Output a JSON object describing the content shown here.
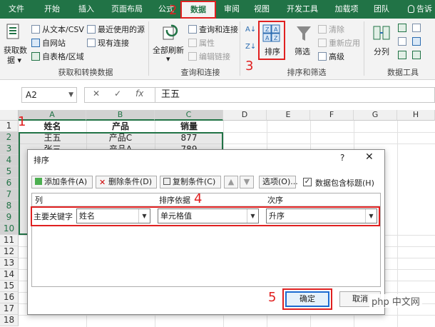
{
  "tabs": [
    "文件",
    "开始",
    "插入",
    "页面布局",
    "公式",
    "数据",
    "审阅",
    "视图",
    "开发工具",
    "加载项",
    "团队"
  ],
  "active_tab_index": 5,
  "tell_me": "告诉",
  "ribbon": {
    "get_data": {
      "big_label_1": "获取数",
      "big_label_2": "据 ▾",
      "from_text": "从文本/CSV",
      "from_web": "自网站",
      "from_table": "自表格/区域",
      "recent": "最近使用的源",
      "existing": "现有连接",
      "group_label": "获取和转换数据"
    },
    "refresh": {
      "big_label_1": "全部刷新",
      "big_label_2": "▾",
      "queries": "查询和连接",
      "properties": "属性",
      "edit_links": "编辑链接",
      "group_label": "查询和连接"
    },
    "sort_filter": {
      "az_top": "A↓",
      "az_bottom": "Z↓",
      "sort_label": "排序",
      "filter_label": "筛选",
      "clear": "清除",
      "reapply": "重新应用",
      "advanced": "高级",
      "group_label": "排序和筛选"
    },
    "data_tools": {
      "split_label": "分列",
      "group_label": "数据工具"
    }
  },
  "formula_bar": {
    "name_box": "A2",
    "cancel": "✕",
    "enter": "✓",
    "fx": "fx",
    "value": "王五"
  },
  "grid": {
    "columns": [
      "A",
      "B",
      "C",
      "D",
      "E",
      "F",
      "G",
      "H"
    ],
    "rows": [
      "1",
      "2",
      "3",
      "4",
      "5",
      "6",
      "7",
      "8",
      "9",
      "10",
      "11",
      "12",
      "13",
      "14",
      "15",
      "16",
      "17",
      "18"
    ],
    "header_cells": [
      "姓名",
      "产品",
      "销量"
    ],
    "row2": [
      "王五",
      "产品C",
      "877"
    ],
    "row3": [
      "张三",
      "产品A",
      "789"
    ]
  },
  "dialog": {
    "title": "排序",
    "help": "?",
    "close": "✕",
    "add_level": "添加条件(A)",
    "delete_level": "删除条件(D)",
    "copy_level": "复制条件(C)",
    "up": "▲",
    "down": "▼",
    "options": "选项(O)...",
    "has_headers": "数据包含标题(H)",
    "has_headers_checked": "✓",
    "col_header": "列",
    "sort_on_header": "排序依据",
    "order_header": "次序",
    "level_label": "主要关键字",
    "column_value": "姓名",
    "sort_on_value": "单元格值",
    "order_value": "升序",
    "ok": "确定",
    "cancel": "取消"
  },
  "annotations": [
    "1",
    "2",
    "3",
    "4",
    "5"
  ],
  "watermark": "php 中文网",
  "colors": {
    "excel_green": "#217346",
    "highlight_red": "#e02020",
    "ok_blue": "#1c6bd1"
  }
}
